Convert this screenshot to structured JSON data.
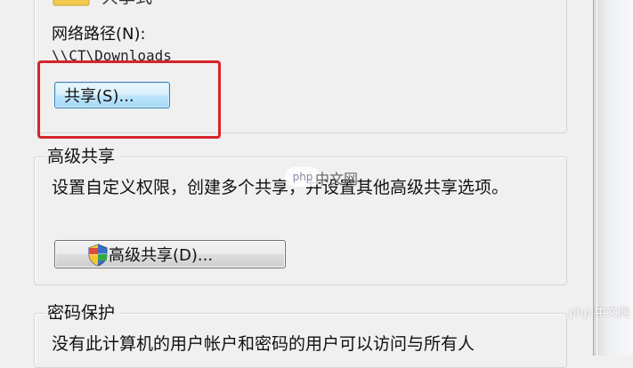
{
  "share_section": {
    "share_name": "共享式",
    "network_path_label": "网络路径(N):",
    "network_path_value": "\\\\CT\\Downloads",
    "share_button": "共享(S)..."
  },
  "advanced_section": {
    "title": "高级共享",
    "description": "设置自定义权限，创建多个共享，并设置其他高级共享选项。",
    "button": "高级共享(D)..."
  },
  "password_section": {
    "title": "密码保护",
    "description": "没有此计算机的用户帐户和密码的用户可以访问与所有人"
  },
  "watermark": {
    "badge": "php",
    "site": "中文网",
    "corner": "php 中文网"
  },
  "highlight": {
    "color": "#d8232a"
  }
}
